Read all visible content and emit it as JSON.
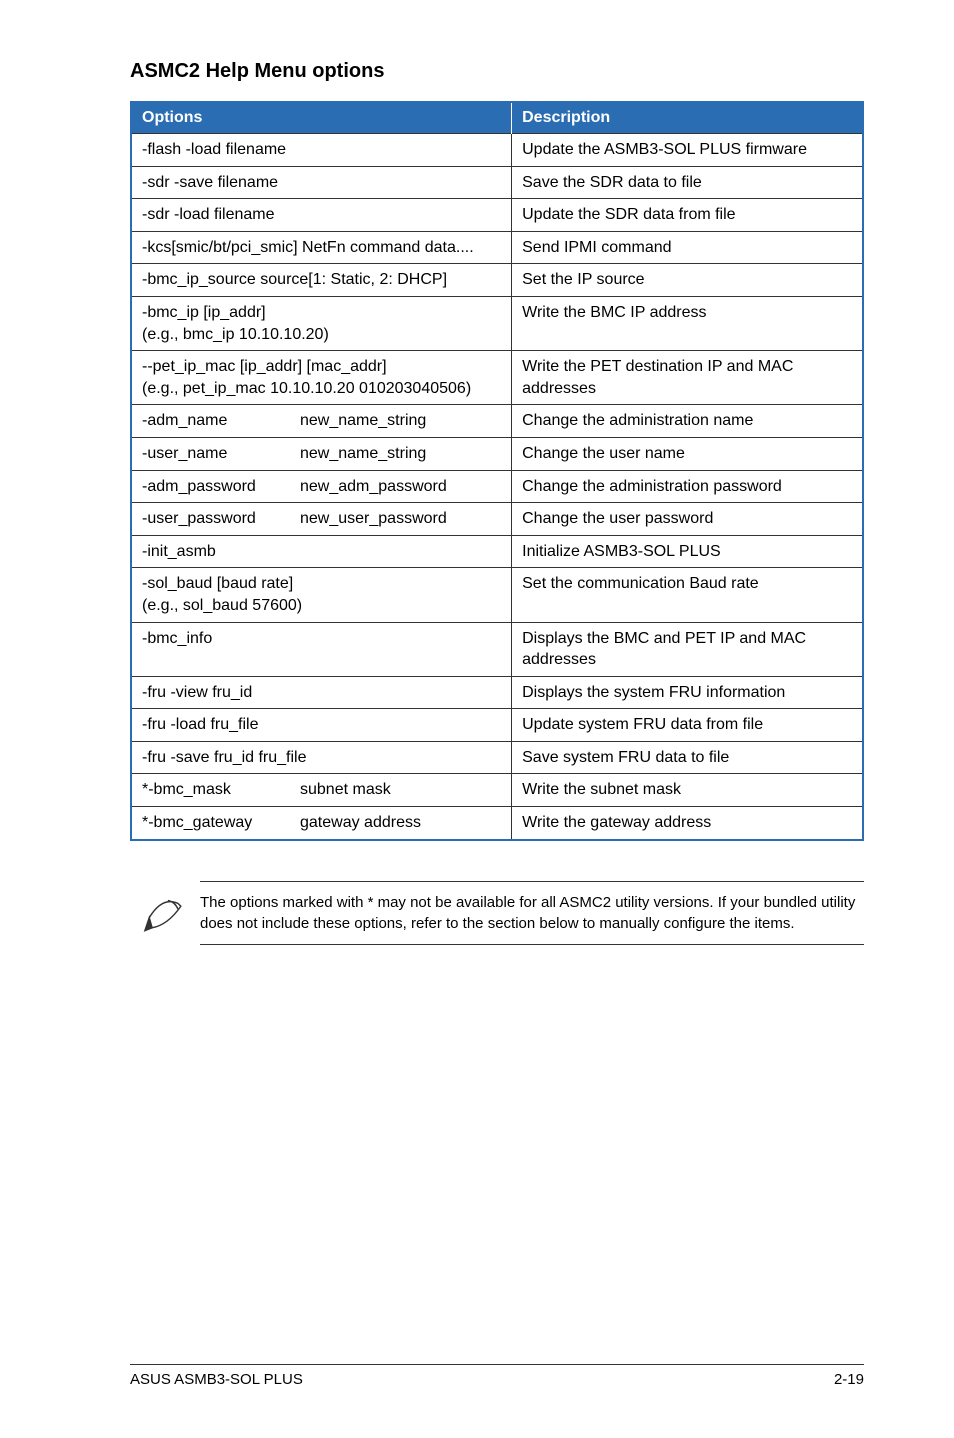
{
  "heading": "ASMC2 Help Menu options",
  "table": {
    "headers": {
      "options": "Options",
      "description": "Description"
    },
    "rows": [
      {
        "opt": "-flash -load filename",
        "desc": "Update the ASMB3-SOL PLUS firmware"
      },
      {
        "opt": "-sdr -save filename",
        "desc": "Save the SDR data to file"
      },
      {
        "opt": "-sdr -load filename",
        "desc": "Update the SDR data from file"
      },
      {
        "opt": "-kcs[smic/bt/pci_smic] NetFn command data....",
        "desc": "Send IPMI command"
      },
      {
        "opt": "-bmc_ip_source source[1: Static, 2: DHCP]",
        "desc": "Set the IP source"
      },
      {
        "opt": "-bmc_ip [ip_addr]\n(e.g., bmc_ip 10.10.10.20)",
        "desc": "Write the BMC IP address"
      },
      {
        "opt": "--pet_ip_mac [ip_addr] [mac_addr]\n(e.g., pet_ip_mac 10.10.10.20 010203040506)",
        "desc": "Write the PET destination IP and MAC addresses"
      },
      {
        "opt_left": "-adm_name",
        "opt_right": "new_name_string",
        "desc": "Change the administration name"
      },
      {
        "opt_left": "-user_name",
        "opt_right": "new_name_string",
        "desc": "Change the user name"
      },
      {
        "opt_left": "-adm_password",
        "opt_right": "new_adm_password",
        "desc": "Change the administration password"
      },
      {
        "opt_left": "-user_password",
        "opt_right": "new_user_password",
        "desc": "Change the user password"
      },
      {
        "opt": "-init_asmb",
        "desc": "Initialize ASMB3-SOL PLUS"
      },
      {
        "opt": "-sol_baud [baud rate]\n(e.g., sol_baud 57600)",
        "desc": "Set the communication Baud rate"
      },
      {
        "opt": "-bmc_info",
        "desc": "Displays the BMC and PET IP and MAC addresses"
      },
      {
        "opt": "-fru -view fru_id",
        "desc": "Displays the system FRU information"
      },
      {
        "opt": "-fru -load fru_file",
        "desc": "Update system FRU data from file"
      },
      {
        "opt": "-fru -save fru_id fru_file",
        "desc": "Save system FRU data to file"
      },
      {
        "opt_left": "*-bmc_mask",
        "opt_right": "subnet mask",
        "desc": "Write the subnet mask"
      },
      {
        "opt_left": "*-bmc_gateway",
        "opt_right": "gateway address",
        "desc": "Write the gateway address"
      }
    ]
  },
  "note": "The options marked with * may not be available for all ASMC2 utility versions. If your bundled utility does not include these options, refer to the section below to manually configure the items.",
  "footer": {
    "left": "ASUS ASMB3-SOL PLUS",
    "right": "2-19"
  }
}
